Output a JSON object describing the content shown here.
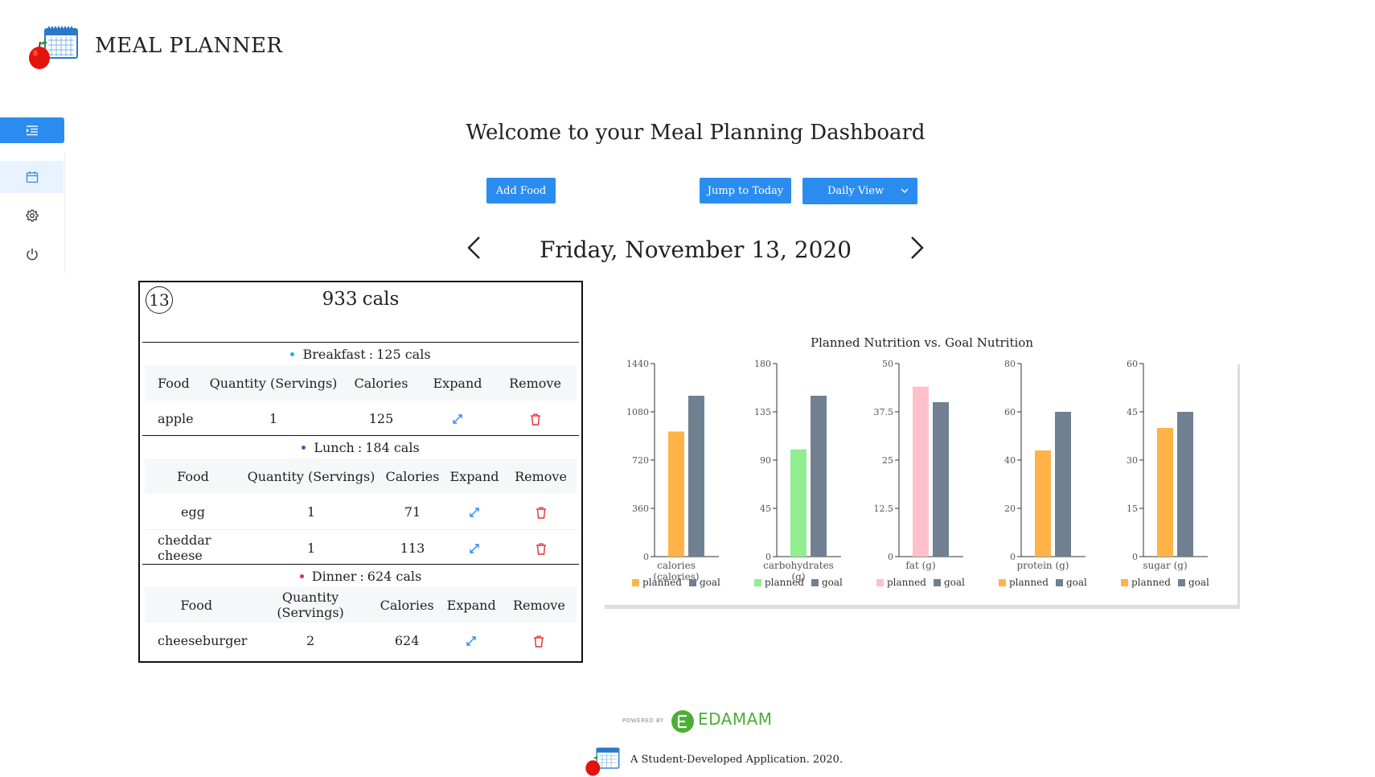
{
  "header": {
    "app_title": "MEAL PLANNER"
  },
  "sidebar": {
    "items": [
      {
        "icon": "indent-menu-icon"
      },
      {
        "icon": "calendar-icon",
        "active": true
      },
      {
        "icon": "gear-icon"
      },
      {
        "icon": "power-icon"
      }
    ]
  },
  "dashboard": {
    "welcome": "Welcome to your Meal Planning Dashboard",
    "add_food_label": "Add Food",
    "jump_today_label": "Jump to Today",
    "view_select": {
      "selected": "Daily View"
    },
    "date_heading": "Friday, November 13, 2020"
  },
  "day_card": {
    "day_number": "13",
    "total_value": "933",
    "total_unit": "cals",
    "meals": [
      {
        "name": "Breakfast",
        "cals": "125 cals",
        "dot_color": "#20b2c8",
        "columns": [
          "Food",
          "Quantity (Servings)",
          "Calories",
          "Expand",
          "Remove"
        ],
        "rows": [
          {
            "food": "apple",
            "quantity": "1",
            "calories": "125"
          }
        ]
      },
      {
        "name": "Lunch",
        "cals": "184 cals",
        "dot_color": "#2b5fd9",
        "columns": [
          "Food",
          "Quantity (Servings)",
          "Calories",
          "Expand",
          "Remove"
        ],
        "rows": [
          {
            "food": "egg",
            "quantity": "1",
            "calories": "71"
          },
          {
            "food": "cheddar cheese",
            "quantity": "1",
            "calories": "113"
          }
        ]
      },
      {
        "name": "Dinner",
        "cals": "624 cals",
        "dot_color": "#e0287d",
        "columns": [
          "Food",
          "Quantity (Servings)",
          "Calories",
          "Expand",
          "Remove"
        ],
        "rows": [
          {
            "food": "cheeseburger",
            "quantity": "2",
            "calories": "624"
          }
        ]
      }
    ]
  },
  "chart_data": {
    "type": "bar",
    "title": "Planned Nutrition vs. Goal Nutrition",
    "legend": [
      "planned",
      "goal"
    ],
    "legend_position": "bottom",
    "panels": [
      {
        "xlabel": "calories\n(calories)",
        "ylim": [
          0,
          1440
        ],
        "yticks": [
          "0",
          "360",
          "720",
          "1080",
          "1440"
        ],
        "planned": 933,
        "goal": 1200,
        "planned_color": "#ffb347",
        "goal_color": "#708090"
      },
      {
        "xlabel": "carbohydrates\n(g)",
        "ylim": [
          0,
          180
        ],
        "yticks": [
          "0",
          "45",
          "90",
          "135",
          "180"
        ],
        "planned": 100,
        "goal": 150,
        "planned_color": "#90ee90",
        "goal_color": "#708090"
      },
      {
        "xlabel": "fat (g)",
        "ylim": [
          0,
          50
        ],
        "yticks": [
          "0",
          "12.5",
          "25",
          "37.5",
          "50"
        ],
        "planned": 44,
        "goal": 40,
        "planned_color": "#ffc0cb",
        "goal_color": "#708090"
      },
      {
        "xlabel": "protein (g)",
        "ylim": [
          0,
          80
        ],
        "yticks": [
          "0",
          "20",
          "40",
          "60",
          "80"
        ],
        "planned": 44,
        "goal": 60,
        "planned_color": "#ffb347",
        "goal_color": "#708090"
      },
      {
        "xlabel": "sugar (g)",
        "ylim": [
          0,
          60
        ],
        "yticks": [
          "0",
          "15",
          "30",
          "45",
          "60"
        ],
        "planned": 40,
        "goal": 45,
        "planned_color": "#ffb347",
        "goal_color": "#708090"
      }
    ]
  },
  "footer": {
    "powered_by": "POWERED BY",
    "brand": "EDAMAM",
    "credit": "A Student-Developed Application. 2020."
  }
}
